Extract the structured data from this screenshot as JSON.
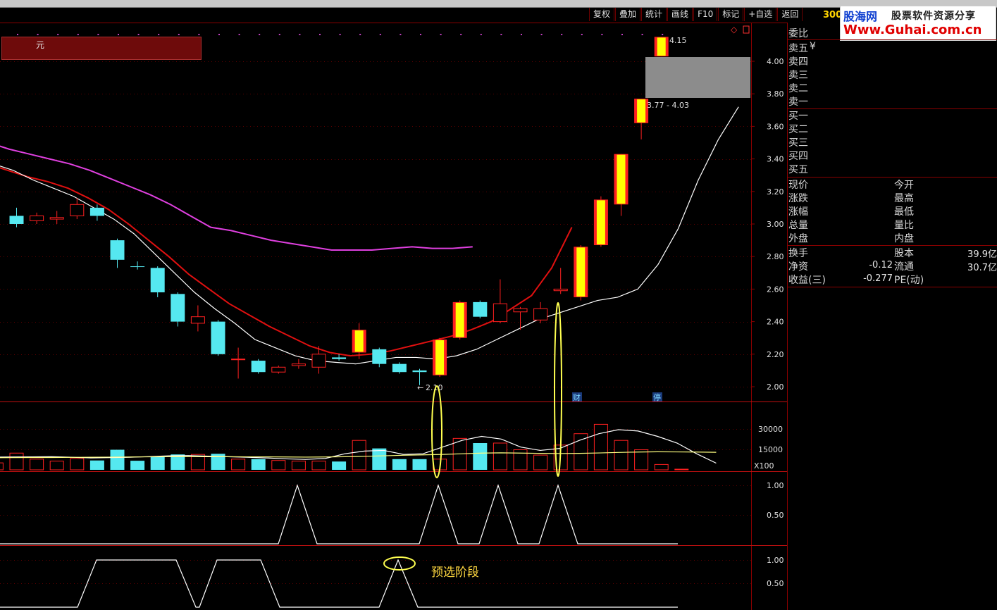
{
  "toolbar": {
    "buttons": [
      "复权",
      "叠加",
      "统计",
      "画线",
      "F10",
      "标记",
      "+自选",
      "返回"
    ]
  },
  "stock": {
    "code_prefix": "300",
    "unit_label": "元",
    "low_marker": "2.10",
    "high_marker": "4.15",
    "range_label": "3.77 - 4.03",
    "badge_cai": "财",
    "badge_ting": "停",
    "vol_unit": "X100"
  },
  "logo": {
    "cn": "股海网",
    "slogan": "股票软件资源分享",
    "url": "Www.Guhai.com.cn"
  },
  "annotation": "预选阶段",
  "axes": {
    "price_ticks": [
      "4.00",
      "3.80",
      "3.60",
      "3.40",
      "3.20",
      "3.00",
      "2.80",
      "2.60",
      "2.40",
      "2.20",
      "2.00"
    ],
    "volume_ticks": [
      "30000",
      "15000"
    ],
    "ind1_ticks": [
      "1.00",
      "0.50"
    ],
    "ind2_ticks": [
      "1.00",
      "0.50"
    ]
  },
  "info": {
    "weibi": "委比",
    "sell": [
      "卖五",
      "卖四",
      "卖三",
      "卖二",
      "卖一"
    ],
    "buy": [
      "买一",
      "买二",
      "买三",
      "买四",
      "买五"
    ],
    "currency": "¥",
    "left_labels": [
      "现价",
      "涨跌",
      "涨幅",
      "总量",
      "外盘"
    ],
    "right_labels": [
      "今开",
      "最高",
      "最低",
      "量比",
      "内盘"
    ],
    "fund": [
      {
        "l": "换手",
        "v1": "",
        "r": "股本",
        "v2": "39.9亿"
      },
      {
        "l": "净资",
        "v1": "-0.12",
        "r": "流通",
        "v2": "30.7亿"
      },
      {
        "l": "收益(三)",
        "v1": "-0.277",
        "r": "PE(动)",
        "v2": ""
      }
    ]
  },
  "colors": {
    "up": "#ff2020",
    "up_fill": "#ffff00",
    "down": "#55e8f0",
    "ma_long": "#e040e0",
    "ma_mid": "#e01010",
    "ma_short": "#ffffff",
    "grid": "#8a0000",
    "ellipse": "#ffff50"
  },
  "chart_data": {
    "type": "candlestick",
    "price_ylim": [
      1.88,
      4.25
    ],
    "candles": [
      {
        "o": 3.05,
        "c": 3.0,
        "h": 3.1,
        "l": 2.98,
        "up": false
      },
      {
        "o": 3.02,
        "c": 3.05,
        "h": 3.07,
        "l": 3.0,
        "up": true
      },
      {
        "o": 3.03,
        "c": 3.04,
        "h": 3.08,
        "l": 3.0,
        "up": true
      },
      {
        "o": 3.05,
        "c": 3.12,
        "h": 3.16,
        "l": 3.03,
        "up": true
      },
      {
        "o": 3.1,
        "c": 3.05,
        "h": 3.12,
        "l": 3.02,
        "up": false
      },
      {
        "o": 2.9,
        "c": 2.78,
        "h": 2.91,
        "l": 2.73,
        "up": false
      },
      {
        "o": 2.74,
        "c": 2.74,
        "h": 2.77,
        "l": 2.72,
        "up": false
      },
      {
        "o": 2.73,
        "c": 2.58,
        "h": 2.74,
        "l": 2.55,
        "up": false
      },
      {
        "o": 2.57,
        "c": 2.4,
        "h": 2.58,
        "l": 2.37,
        "up": false
      },
      {
        "o": 2.39,
        "c": 2.43,
        "h": 2.5,
        "l": 2.34,
        "up": true
      },
      {
        "o": 2.4,
        "c": 2.2,
        "h": 2.41,
        "l": 2.19,
        "up": false
      },
      {
        "o": 2.17,
        "c": 2.17,
        "h": 2.24,
        "l": 2.05,
        "up": true
      },
      {
        "o": 2.16,
        "c": 2.09,
        "h": 2.17,
        "l": 2.08,
        "up": false
      },
      {
        "o": 2.09,
        "c": 2.12,
        "h": 2.13,
        "l": 2.08,
        "up": true
      },
      {
        "o": 2.13,
        "c": 2.14,
        "h": 2.17,
        "l": 2.11,
        "up": true
      },
      {
        "o": 2.12,
        "c": 2.2,
        "h": 2.25,
        "l": 2.08,
        "up": true
      },
      {
        "o": 2.18,
        "c": 2.17,
        "h": 2.2,
        "l": 2.16,
        "up": false
      },
      {
        "o": 2.21,
        "c": 2.35,
        "h": 2.39,
        "l": 2.17,
        "up": true
      },
      {
        "o": 2.23,
        "c": 2.14,
        "h": 2.24,
        "l": 2.12,
        "up": false
      },
      {
        "o": 2.14,
        "c": 2.09,
        "h": 2.15,
        "l": 2.08,
        "up": false
      },
      {
        "o": 2.1,
        "c": 2.09,
        "h": 2.11,
        "l": 2.01,
        "up": false
      },
      {
        "o": 2.07,
        "c": 2.29,
        "h": 2.3,
        "l": 2.06,
        "up": true
      },
      {
        "o": 2.3,
        "c": 2.52,
        "h": 2.53,
        "l": 2.29,
        "up": true
      },
      {
        "o": 2.52,
        "c": 2.43,
        "h": 2.53,
        "l": 2.42,
        "up": false
      },
      {
        "o": 2.4,
        "c": 2.51,
        "h": 2.66,
        "l": 2.39,
        "up": true
      },
      {
        "o": 2.46,
        "c": 2.48,
        "h": 2.49,
        "l": 2.35,
        "up": true
      },
      {
        "o": 2.41,
        "c": 2.48,
        "h": 2.52,
        "l": 2.39,
        "up": true
      },
      {
        "o": 2.59,
        "c": 2.6,
        "h": 2.73,
        "l": 2.57,
        "up": true
      },
      {
        "o": 2.55,
        "c": 2.86,
        "h": 2.87,
        "l": 2.53,
        "up": true
      },
      {
        "o": 2.87,
        "c": 3.15,
        "h": 3.17,
        "l": 2.86,
        "up": true
      },
      {
        "o": 3.12,
        "c": 3.43,
        "h": 3.43,
        "l": 3.05,
        "up": true
      },
      {
        "o": 3.62,
        "c": 3.77,
        "h": 3.77,
        "l": 3.52,
        "up": true
      },
      {
        "o": 4.03,
        "c": 4.15,
        "h": 4.15,
        "l": 4.03,
        "up": true
      }
    ],
    "ma_short": [
      3.37,
      3.33,
      3.27,
      3.22,
      3.17,
      3.1,
      3.03,
      2.94,
      2.82,
      2.7,
      2.58,
      2.48,
      2.39,
      2.29,
      2.24,
      2.19,
      2.16,
      2.15,
      2.14,
      2.16,
      2.18,
      2.18,
      2.17,
      2.19,
      2.23,
      2.29,
      2.35,
      2.41,
      2.45,
      2.49,
      2.53,
      2.55,
      2.6,
      2.75,
      2.97,
      3.27,
      3.52,
      3.72
    ],
    "ma_mid": [
      3.46,
      3.41,
      3.37,
      3.33,
      3.29,
      3.26,
      3.22,
      3.16,
      3.09,
      3.0,
      2.9,
      2.8,
      2.69,
      2.6,
      2.51,
      2.44,
      2.37,
      2.31,
      2.25,
      2.21,
      2.19,
      2.2,
      2.22,
      2.25,
      2.28,
      2.31,
      2.35,
      2.4,
      2.48,
      2.56,
      2.73,
      2.98
    ],
    "ma_long": [
      3.67,
      3.62,
      3.58,
      3.54,
      3.5,
      3.46,
      3.43,
      3.4,
      3.37,
      3.33,
      3.28,
      3.23,
      3.18,
      3.12,
      3.05,
      2.98,
      2.96,
      2.93,
      2.9,
      2.88,
      2.86,
      2.84,
      2.84,
      2.84,
      2.85,
      2.86
    ],
    "volume": [
      {
        "v": 5200,
        "up": true
      },
      {
        "v": 12500,
        "up": true
      },
      {
        "v": 8000,
        "up": true
      },
      {
        "v": 6500,
        "up": true
      },
      {
        "v": 8500,
        "up": true
      },
      {
        "v": 7000,
        "up": false
      },
      {
        "v": 15000,
        "up": false
      },
      {
        "v": 6800,
        "up": false
      },
      {
        "v": 10000,
        "up": false
      },
      {
        "v": 11500,
        "up": false
      },
      {
        "v": 11500,
        "up": true
      },
      {
        "v": 12000,
        "up": false
      },
      {
        "v": 8000,
        "up": true
      },
      {
        "v": 8000,
        "up": false
      },
      {
        "v": 7000,
        "up": true
      },
      {
        "v": 6500,
        "up": true
      },
      {
        "v": 6500,
        "up": true
      },
      {
        "v": 6200,
        "up": false
      },
      {
        "v": 22000,
        "up": true
      },
      {
        "v": 16000,
        "up": false
      },
      {
        "v": 8000,
        "up": false
      },
      {
        "v": 8000,
        "up": false
      },
      {
        "v": 8000,
        "up": true
      },
      {
        "v": 23500,
        "up": true
      },
      {
        "v": 20000,
        "up": false
      },
      {
        "v": 20000,
        "up": true
      },
      {
        "v": 15000,
        "up": true
      },
      {
        "v": 11000,
        "up": true
      },
      {
        "v": 18500,
        "up": true
      },
      {
        "v": 27000,
        "up": true
      },
      {
        "v": 34000,
        "up": true
      },
      {
        "v": 22000,
        "up": true
      },
      {
        "v": 15000,
        "up": true
      },
      {
        "v": 4000,
        "up": true
      },
      {
        "v": 500,
        "up": true
      }
    ],
    "vol_ma1": [
      9500,
      9600,
      9700,
      9800,
      9400,
      8900,
      9100,
      9400,
      9900,
      10500,
      10700,
      10200,
      9800,
      9400,
      8900,
      8200,
      7800,
      8500,
      12000,
      14000,
      14500,
      11500,
      12000,
      17000,
      22000,
      25000,
      23000,
      17000,
      14500,
      16000,
      22000,
      27000,
      30000,
      29000,
      25000,
      20000,
      12000,
      5000
    ],
    "vol_ma2": [
      9000,
      9100,
      9200,
      9200,
      9300,
      9400,
      9500,
      9600,
      9700,
      9800,
      9800,
      9800,
      9800,
      9700,
      9700,
      9600,
      9500,
      9600,
      9800,
      10100,
      10500,
      10900,
      11200,
      11500,
      12000,
      12500,
      12700,
      12500,
      12300,
      12200,
      12300,
      12600,
      13000,
      13300,
      13500,
      13400,
      13300,
      13100
    ],
    "indicator1": [
      [
        0,
        0
      ],
      [
        0,
        1
      ],
      [
        0,
        0
      ],
      [
        1,
        1
      ],
      [
        1,
        0
      ],
      [
        1,
        1
      ],
      [
        1,
        0
      ],
      [
        0,
        1
      ],
      [
        0,
        0
      ]
    ],
    "indicator2": [
      [
        0,
        0
      ],
      [
        0,
        0
      ],
      [
        1,
        1
      ],
      [
        0,
        0
      ],
      [
        1,
        1
      ],
      [
        0,
        0
      ],
      [
        0,
        1
      ],
      [
        0,
        0
      ]
    ]
  }
}
